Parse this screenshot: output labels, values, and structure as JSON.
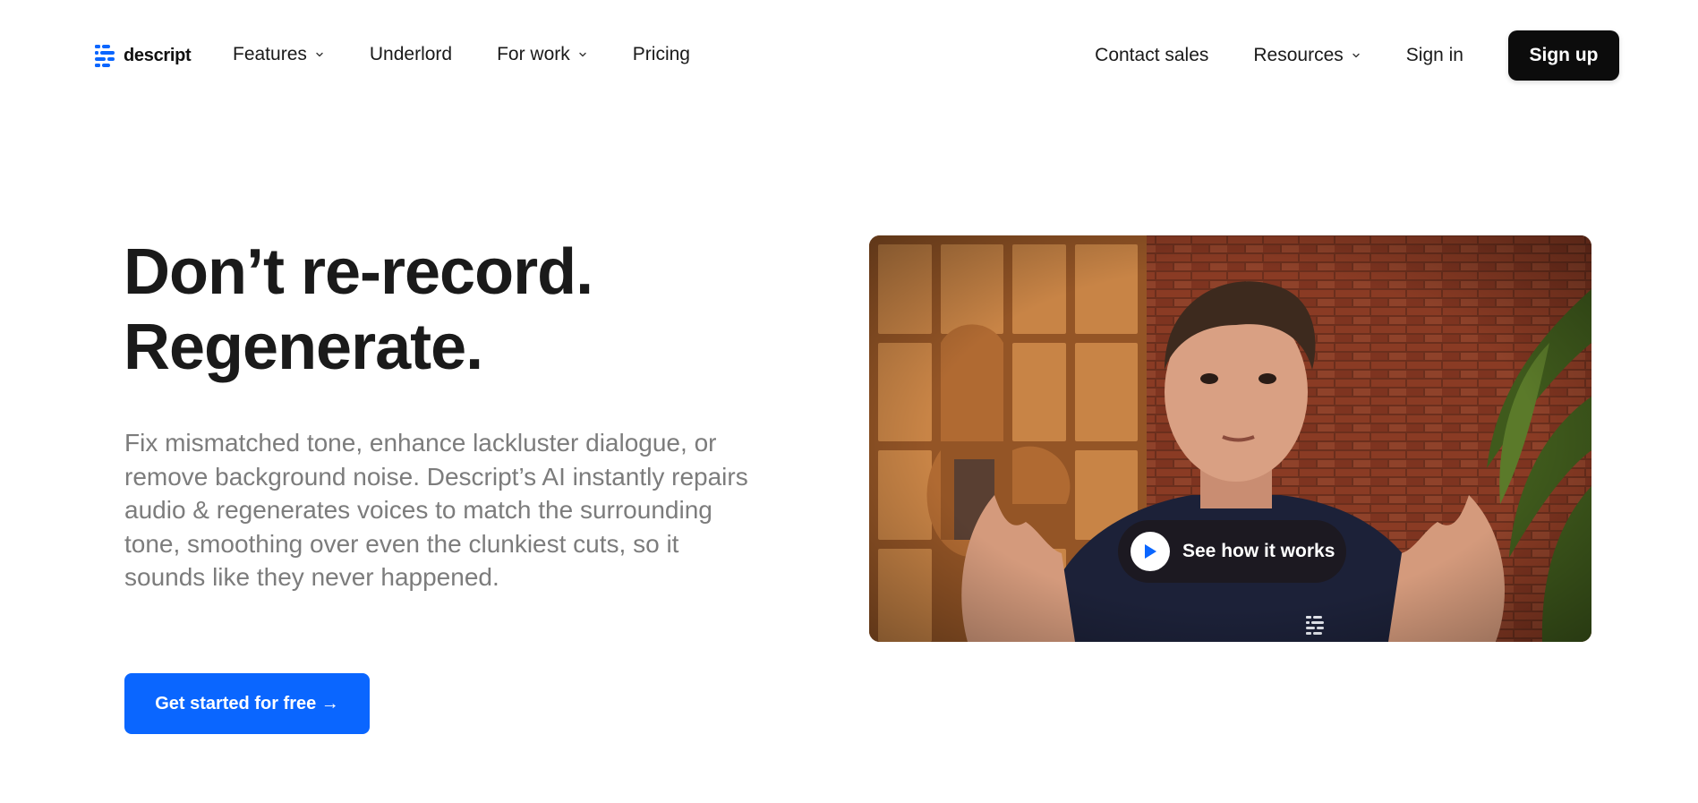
{
  "brand": {
    "name": "descript",
    "color": "#0a66ff"
  },
  "nav": {
    "left": [
      {
        "label": "Features",
        "has_dropdown": true
      },
      {
        "label": "Underlord",
        "has_dropdown": false
      },
      {
        "label": "For work",
        "has_dropdown": true
      },
      {
        "label": "Pricing",
        "has_dropdown": false
      }
    ],
    "right": [
      {
        "label": "Contact sales",
        "has_dropdown": false
      },
      {
        "label": "Resources",
        "has_dropdown": true
      },
      {
        "label": "Sign in",
        "has_dropdown": false
      }
    ],
    "signup_label": "Sign up"
  },
  "hero": {
    "title_line1": "Don’t re-record.",
    "title_line2": "Regenerate.",
    "description": "Fix mismatched tone, enhance lackluster dialogue, or remove background noise. Descript’s AI instantly repairs audio & regenerates voices to match the surrounding tone, smoothing over even the clunkiest cuts, so it sounds like they never happened.",
    "cta_label": "Get started for free →",
    "cta_color": "#0a66ff"
  },
  "video": {
    "play_label": "See how it works",
    "play_icon": "play-icon"
  }
}
